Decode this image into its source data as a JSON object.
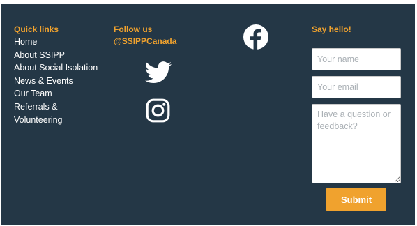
{
  "colors": {
    "background": "#243746",
    "accent": "#f0a22e",
    "text": "#ffffff"
  },
  "quick_links": {
    "heading": "Quick links",
    "items": [
      {
        "label": "Home"
      },
      {
        "label": "About SSIPP"
      },
      {
        "label": "About Social Isolation"
      },
      {
        "label": "News & Events"
      },
      {
        "label": "Our Team"
      },
      {
        "label": "Referrals &"
      },
      {
        "label": "Volunteering"
      }
    ]
  },
  "follow": {
    "heading": "Follow us",
    "handle": "@SSIPPCanada",
    "icons": [
      "facebook-icon",
      "twitter-icon",
      "instagram-icon"
    ]
  },
  "contact": {
    "heading": "Say hello!",
    "name_placeholder": "Your name",
    "email_placeholder": "Your email",
    "message_placeholder": "Have a question or feedback?",
    "submit_label": "Submit"
  }
}
